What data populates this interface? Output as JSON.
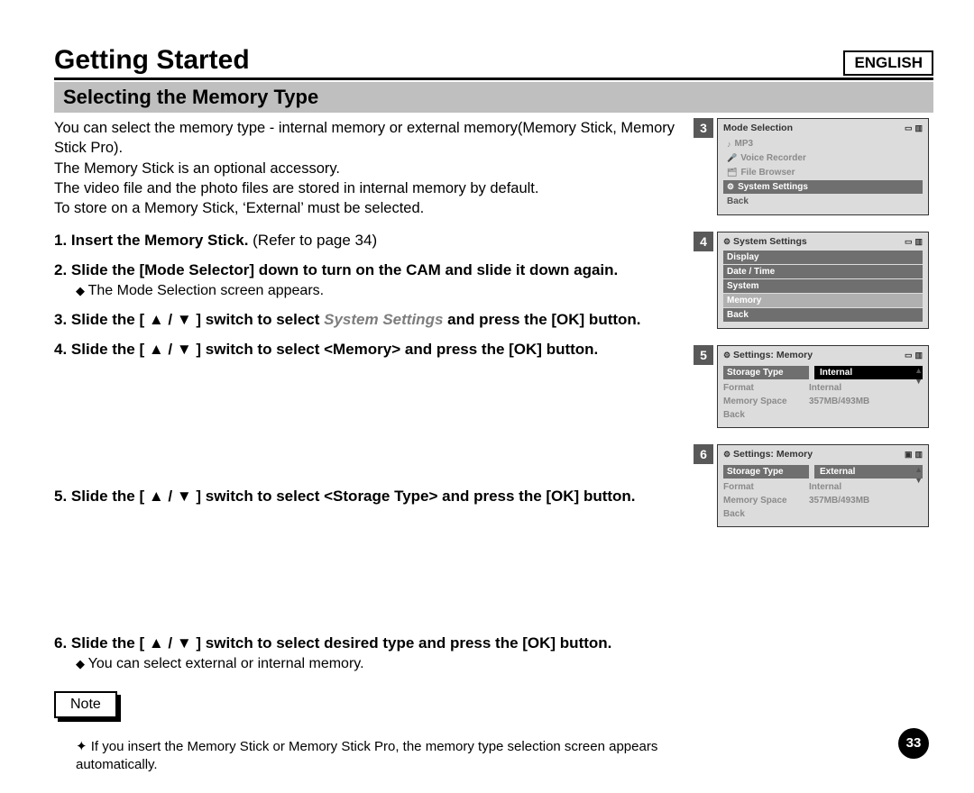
{
  "language": "ENGLISH",
  "chapter": "Getting Started",
  "section": "Selecting the Memory Type",
  "intro": [
    "You can select the memory type - internal memory or external memory(Memory Stick, Memory Stick Pro).",
    "The Memory Stick is an optional accessory.",
    "The video file and the photo files are stored in internal memory by default.",
    "To store on a Memory Stick, ‘External’ must be selected."
  ],
  "steps": {
    "s1": {
      "bold": "Insert the Memory Stick.",
      "light": " (Refer to page 34)"
    },
    "s2": {
      "bold": "Slide the [Mode Selector] down to turn on the CAM and slide it down again.",
      "sub": "The Mode Selection screen appears."
    },
    "s3": {
      "prefix": "Slide the [ ",
      "mid": " ] switch to select ",
      "target": "System Settings",
      "suffix": " and press the [OK] button."
    },
    "s4": {
      "prefix": "Slide the [ ",
      "mid": " ] switch to select <Memory> and press the [OK] button."
    },
    "s5": {
      "prefix": "Slide the [ ",
      "mid": " ] switch to select <Storage Type> and press the [OK] button."
    },
    "s6": {
      "prefix": "Slide the [ ",
      "mid": " ] switch to select desired type and press the [OK] button.",
      "sub": "You can select external or internal memory."
    }
  },
  "note_label": "Note",
  "note_text": "If you insert the Memory Stick or Memory Stick Pro, the memory type selection screen appears automatically.",
  "triangles": "▲ / ▼",
  "screens": {
    "sc3": {
      "badge": "3",
      "title": "Mode Selection",
      "items": [
        "MP3",
        "Voice Recorder",
        "File Browser",
        "System Settings",
        "Back"
      ],
      "selected": "System Settings"
    },
    "sc4": {
      "badge": "4",
      "title": "System Settings",
      "items": [
        "Display",
        "Date / Time",
        "System",
        "Memory",
        "Back"
      ],
      "selected": "Memory"
    },
    "sc5": {
      "badge": "5",
      "title": "Settings: Memory",
      "rows": [
        {
          "k": "Storage Type",
          "v": "Internal",
          "hl": true
        },
        {
          "k": "Format",
          "v": "Internal"
        },
        {
          "k": "Memory Space",
          "v": "357MB/493MB"
        },
        {
          "k": "Back",
          "v": ""
        }
      ]
    },
    "sc6": {
      "badge": "6",
      "title": "Settings: Memory",
      "rows": [
        {
          "k": "Storage Type",
          "v": "External",
          "hl": true
        },
        {
          "k": "Format",
          "v": "Internal"
        },
        {
          "k": "Memory Space",
          "v": "357MB/493MB"
        },
        {
          "k": "Back",
          "v": ""
        }
      ]
    }
  },
  "page_number": "33"
}
